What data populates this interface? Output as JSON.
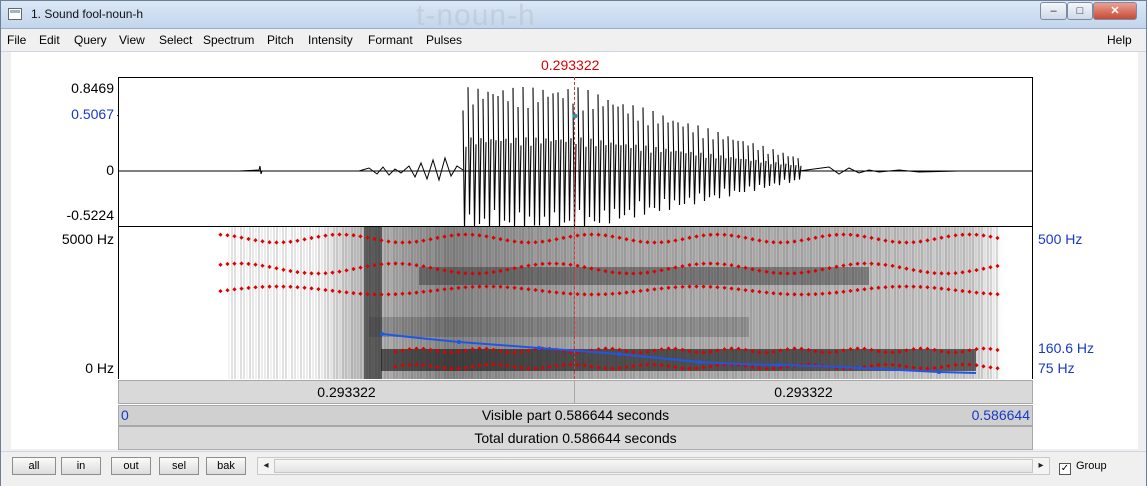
{
  "window": {
    "title": "1. Sound fool-noun-h",
    "ghost_title": "t-noun-h"
  },
  "window_controls": {
    "minimize": "–",
    "maximize": "□",
    "close": "✕"
  },
  "menu": {
    "items": [
      "File",
      "Edit",
      "Query",
      "View",
      "Select",
      "Spectrum",
      "Pitch",
      "Intensity",
      "Formant",
      "Pulses"
    ],
    "help": "Help"
  },
  "cursor": {
    "time_label": "0.293322"
  },
  "waveform": {
    "y_max": "0.8469",
    "y_cursor": "0.5067",
    "y_zero": "0",
    "y_min": "-0.5224"
  },
  "spectrogram": {
    "left_top": "5000 Hz",
    "left_bottom": "0 Hz",
    "right_top": "500 Hz",
    "right_pitch": "160.6 Hz",
    "right_bottom": "75 Hz"
  },
  "time_bar": {
    "left_segment": "0.293322",
    "right_segment": "0.293322",
    "visible_start": "0",
    "visible_text": "Visible part 0.586644 seconds",
    "visible_end": "0.586644",
    "total_text": "Total duration 0.586644 seconds"
  },
  "bottom_buttons": [
    "all",
    "in",
    "out",
    "sel",
    "bak"
  ],
  "scroll": {
    "left_arrow": "◂",
    "right_arrow": "▸"
  },
  "group": {
    "label": "Group",
    "checked_mark": "✓"
  },
  "colors": {
    "cursor": "#d00000",
    "axis_blue": "#1838c9",
    "formant_dots": "#e00000",
    "pitch_line": "#1e56e6"
  }
}
